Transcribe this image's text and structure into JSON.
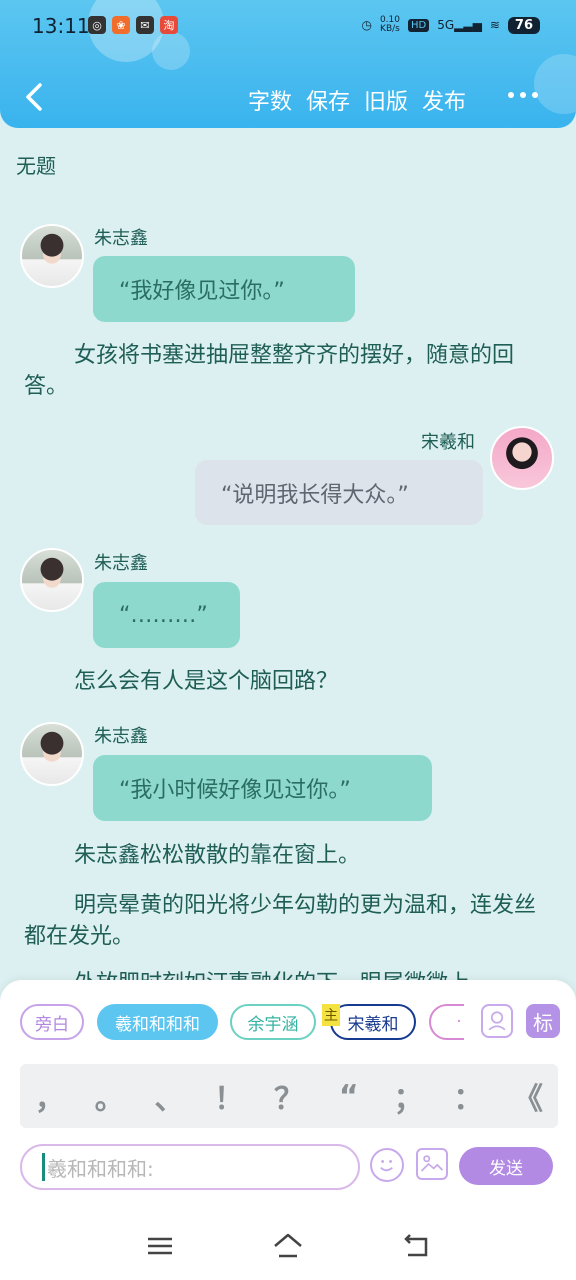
{
  "status_bar": {
    "time": "13:11",
    "net_speed_top": "0.10",
    "net_speed_unit": "KB/s",
    "hd": "HD",
    "signal": "5G",
    "battery": "76"
  },
  "header": {
    "buttons": [
      "字数",
      "保存",
      "旧版",
      "发布"
    ]
  },
  "document": {
    "title": "无题"
  },
  "messages": [
    {
      "speaker": "朱志鑫",
      "text": "“我好像见过你。”"
    },
    {
      "narration": "女孩将书塞进抽屉整整齐齐的摆好，随意的回答。"
    },
    {
      "speaker": "宋羲和",
      "text": "“说明我长得大众。”"
    },
    {
      "speaker": "朱志鑫",
      "text": "“………”"
    },
    {
      "narration": "怎么会有人是这个脑回路？"
    },
    {
      "speaker": "朱志鑫",
      "text": "“我小时候好像见过你。”"
    },
    {
      "narration": "朱志鑫松松散散的靠在窗上。"
    },
    {
      "narration": "明亮晕黄的阳光将少年勾勒的更为温和，连发丝都在发光。"
    },
    {
      "narration": "外放肥时刻如汀事融化的下，眼尾微微上"
    }
  ],
  "composer": {
    "roles": [
      "旁白",
      "羲和和和和",
      "余宇涵",
      "宋羲和",
      "·"
    ],
    "main_tag": "主",
    "biao": "标",
    "punctuation": [
      "，",
      "。",
      "、",
      "！",
      "？",
      "“",
      "；",
      "：",
      "《"
    ],
    "input_placeholder": "羲和和和和:",
    "send": "发送"
  },
  "colors": {
    "header": "#39b3ee",
    "teal_bubble": "#8ed9ce",
    "gray_bubble": "#dde3ea",
    "send": "#b28ae3"
  }
}
